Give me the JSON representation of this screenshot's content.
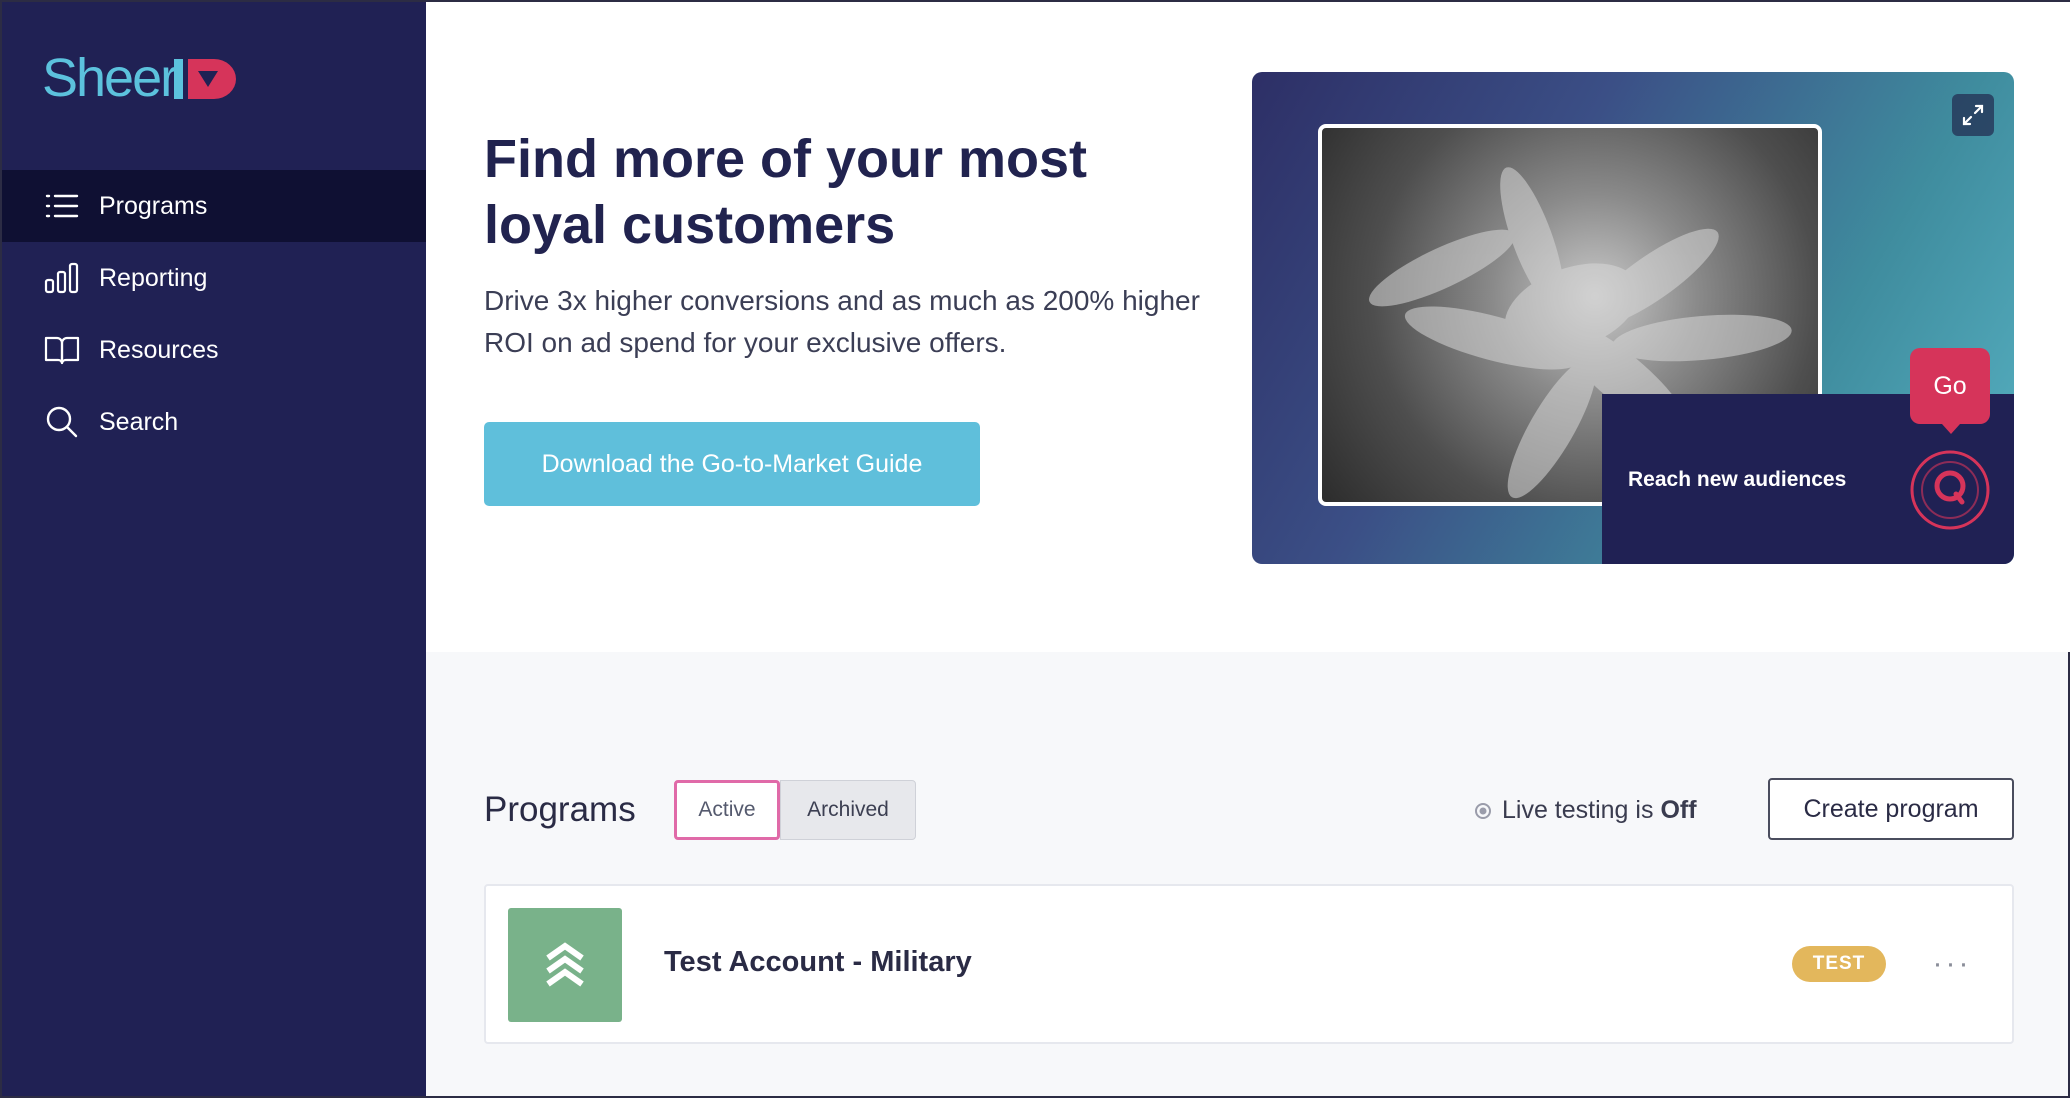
{
  "brand": {
    "logo_text": "Sheer",
    "logo_mark": "ID",
    "accent": "#5cc2dd",
    "mark_color": "#d6345a"
  },
  "sidebar": {
    "items": [
      {
        "label": "Programs",
        "icon": "list-icon",
        "active": true
      },
      {
        "label": "Reporting",
        "icon": "bar-chart-icon",
        "active": false
      },
      {
        "label": "Resources",
        "icon": "book-icon",
        "active": false
      },
      {
        "label": "Search",
        "icon": "search-icon",
        "active": false
      }
    ]
  },
  "hero": {
    "title": "Find more of your most loyal customers",
    "subtitle": "Drive 3x higher conversions and as much as 200% higher ROI on ad spend for your exclusive offers.",
    "cta_label": "Download the Go-to-Market Guide",
    "media": {
      "caption": "Reach new audiences",
      "go_label": "Go",
      "expand_icon": "expand-icon"
    }
  },
  "programs": {
    "title": "Programs",
    "tabs": [
      {
        "label": "Active",
        "selected": true
      },
      {
        "label": "Archived",
        "selected": false
      }
    ],
    "live_testing_prefix": "Live testing is",
    "live_testing_state": "Off",
    "create_label": "Create program",
    "list": [
      {
        "name": "Test Account - Military",
        "badge": "TEST",
        "more": "···",
        "avatar_color": "#79b28a"
      }
    ]
  }
}
